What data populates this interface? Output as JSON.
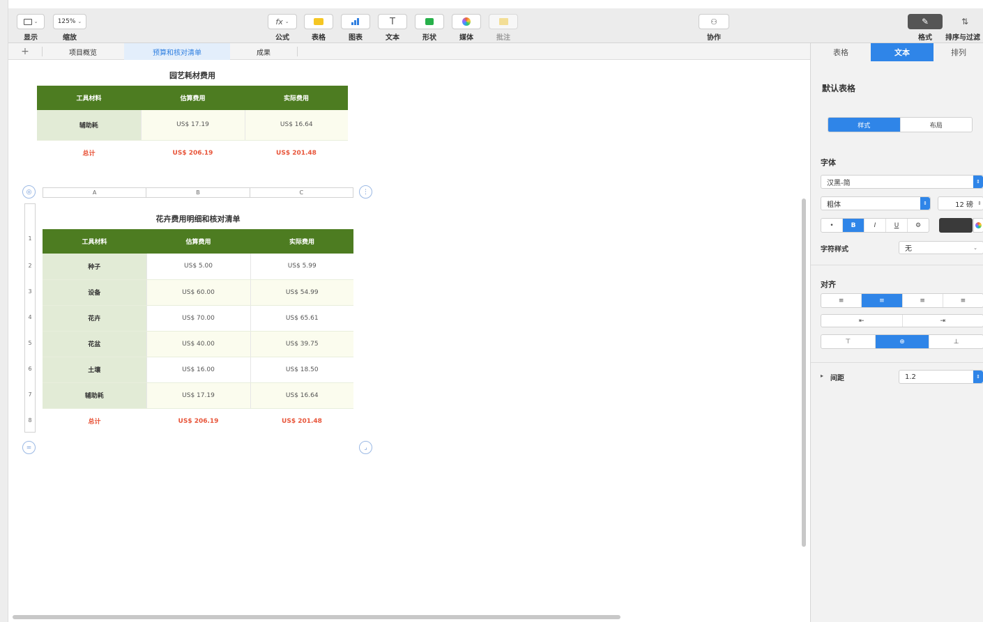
{
  "toolbar": {
    "view_label": "显示",
    "zoom_value": "125%",
    "zoom_label": "缩放",
    "formula_icon": "fx",
    "formula_label": "公式",
    "table_label": "表格",
    "chart_label": "图表",
    "text_icon": "T",
    "text_label": "文本",
    "shape_label": "形状",
    "media_label": "媒体",
    "comment_label": "批注",
    "collab_label": "协作",
    "format_label": "格式",
    "sort_label": "排序与过滤"
  },
  "tabs": {
    "add": "+",
    "items": [
      "项目概览",
      "预算和核对清单",
      "成果"
    ],
    "active_index": 1
  },
  "table1": {
    "title": "园艺耗材费用",
    "headers": [
      "工具材料",
      "估算费用",
      "实际费用"
    ],
    "rows": [
      [
        "辅助耗",
        "US$ 17.19",
        "US$ 16.64"
      ]
    ],
    "total": [
      "总计",
      "US$ 206.19",
      "US$ 201.48"
    ]
  },
  "table2": {
    "title": "花卉费用明细和核对清单",
    "col_headers": [
      "A",
      "B",
      "C"
    ],
    "row_numbers": [
      "1",
      "2",
      "3",
      "4",
      "5",
      "6",
      "7",
      "8"
    ],
    "headers": [
      "工具材料",
      "估算费用",
      "实际费用"
    ],
    "rows": [
      [
        "种子",
        "US$ 5.00",
        "US$ 5.99"
      ],
      [
        "设备",
        "US$ 60.00",
        "US$ 54.99"
      ],
      [
        "花卉",
        "US$ 70.00",
        "US$ 65.61"
      ],
      [
        "花盆",
        "US$ 40.00",
        "US$ 39.75"
      ],
      [
        "土壤",
        "US$ 16.00",
        "US$ 18.50"
      ],
      [
        "辅助耗",
        "US$ 17.19",
        "US$ 16.64"
      ]
    ],
    "total": [
      "总计",
      "US$ 206.19",
      "US$ 201.48"
    ]
  },
  "sidebar": {
    "tabs": [
      "表格",
      "文本",
      "排列"
    ],
    "active_tab": 1,
    "style_name": "默认表格",
    "seg": [
      "样式",
      "布局"
    ],
    "font_section": "字体",
    "font_family": "汉黑-简",
    "font_weight": "粗体",
    "font_size": "12 磅",
    "style_buttons": [
      "•",
      "B",
      "I",
      "U",
      "⚙"
    ],
    "char_style_label": "字符样式",
    "char_style_value": "无",
    "align_section": "对齐",
    "align_buttons": [
      "≡",
      "≡",
      "≡",
      "≡"
    ],
    "indent_buttons": [
      "⇤",
      "⇥"
    ],
    "valign_buttons": [
      "⊤",
      "⊕",
      "⊥"
    ],
    "spacing_label": "间距",
    "spacing_value": "1.2"
  },
  "colors": {
    "header_green": "#4d7c21",
    "first_col": "#e2ebd6",
    "total_red": "#e8553a",
    "accent_blue": "#2f85e8"
  }
}
